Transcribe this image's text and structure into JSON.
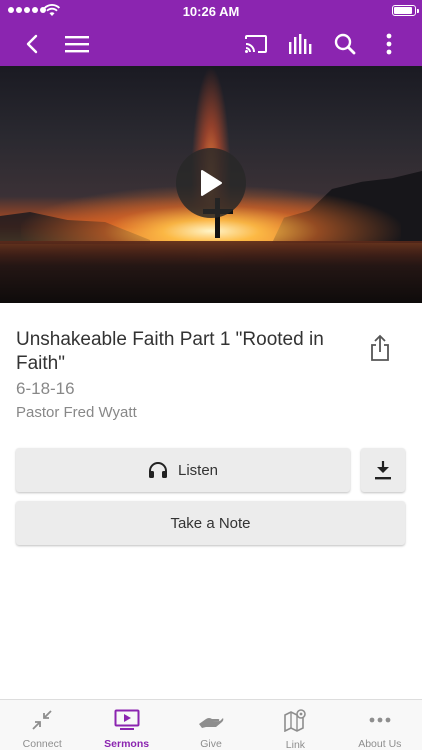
{
  "status_bar": {
    "time": "10:26 AM"
  },
  "app_bar": {
    "back_icon": "chevron-left-icon",
    "menu_icon": "hamburger-icon",
    "cast_icon": "cast-icon",
    "audio_icon": "equalizer-icon",
    "search_icon": "search-icon",
    "more_icon": "more-vertical-icon"
  },
  "sermon": {
    "title": "Unshakeable Faith Part 1 \"Rooted in Faith\"",
    "date": "6-18-16",
    "pastor": "Pastor Fred Wyatt"
  },
  "actions": {
    "listen_label": "Listen",
    "note_label": "Take a Note"
  },
  "tabs": [
    {
      "label": "Connect",
      "icon": "arrows-in-icon",
      "active": false
    },
    {
      "label": "Sermons",
      "icon": "video-play-icon",
      "active": true
    },
    {
      "label": "Give",
      "icon": "giving-hand-icon",
      "active": false
    },
    {
      "label": "Link",
      "icon": "map-pin-icon",
      "active": false
    },
    {
      "label": "About Us",
      "icon": "ellipsis-icon",
      "active": false
    }
  ],
  "colors": {
    "brand": "#8b25b0",
    "tab_inactive": "#8e8e8e"
  }
}
